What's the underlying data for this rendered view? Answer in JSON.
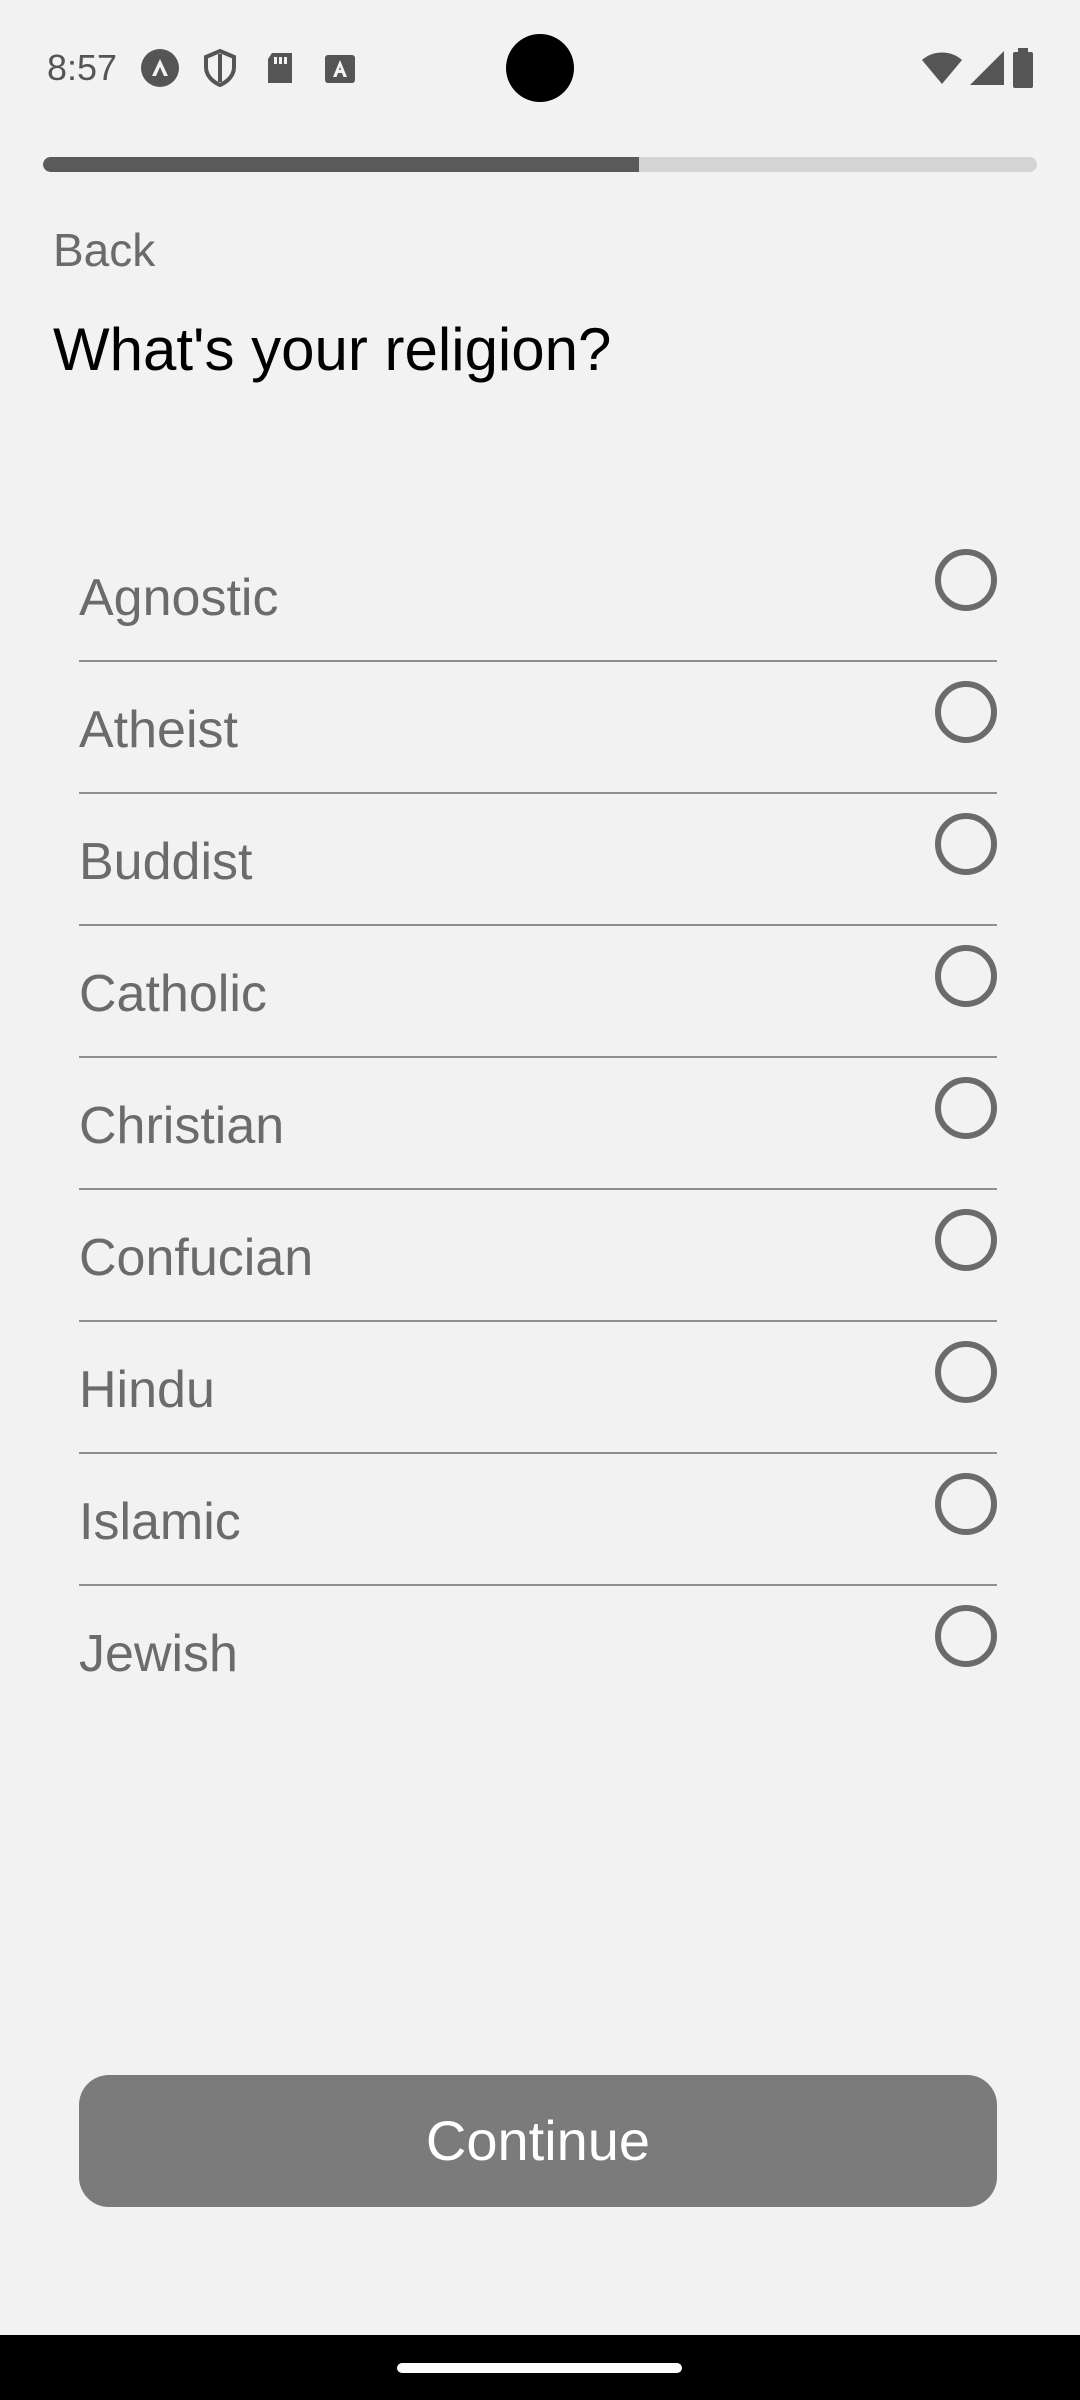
{
  "status_bar": {
    "time": "8:57",
    "left_icons": [
      "app-a-icon",
      "shield-icon",
      "sd-card-icon",
      "text-a-icon"
    ],
    "right_icons": [
      "wifi-icon",
      "signal-icon",
      "battery-icon"
    ]
  },
  "progress": {
    "fraction": 0.6
  },
  "nav": {
    "back_label": "Back"
  },
  "page": {
    "title": "What's your religion?"
  },
  "options": [
    {
      "label": "Agnostic",
      "selected": false
    },
    {
      "label": "Atheist",
      "selected": false
    },
    {
      "label": "Buddist",
      "selected": false
    },
    {
      "label": "Catholic",
      "selected": false
    },
    {
      "label": "Christian",
      "selected": false
    },
    {
      "label": "Confucian",
      "selected": false
    },
    {
      "label": "Hindu",
      "selected": false
    },
    {
      "label": "Islamic",
      "selected": false
    },
    {
      "label": "Jewish",
      "selected": false
    }
  ],
  "actions": {
    "continue_label": "Continue"
  },
  "colors": {
    "background": "#f2f2f2",
    "progress_fill": "#5a5a5a",
    "progress_track": "#d4d4d4",
    "button": "#7b7b7b"
  }
}
